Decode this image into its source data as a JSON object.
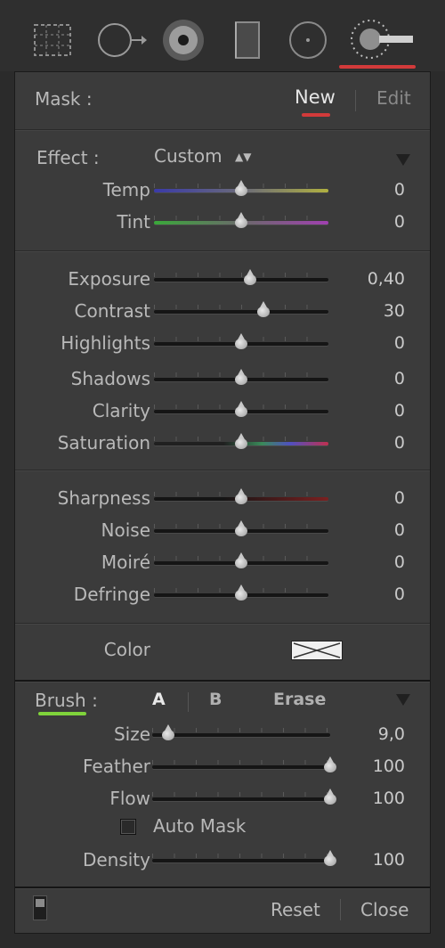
{
  "toolbar": {
    "tools": [
      "crop-overlay-icon",
      "spot-removal-icon",
      "red-eye-icon",
      "graduated-filter-icon",
      "radial-filter-icon",
      "adjustment-brush-icon"
    ]
  },
  "mask": {
    "label": "Mask :",
    "new_label": "New",
    "edit_label": "Edit"
  },
  "effect": {
    "label": "Effect :",
    "value": "Custom"
  },
  "groups": [
    [
      {
        "label": "Temp",
        "value": "0",
        "pos": 0.5,
        "track": "temp"
      },
      {
        "label": "Tint",
        "value": "0",
        "pos": 0.5,
        "track": "tint"
      }
    ],
    [
      {
        "label": "Exposure",
        "value": "0,40",
        "pos": 0.55,
        "track": "plain"
      },
      {
        "label": "Contrast",
        "value": "30",
        "pos": 0.63,
        "track": "plain"
      },
      {
        "label": "Highlights",
        "value": "0",
        "pos": 0.5,
        "track": "plain"
      },
      {
        "label": "Shadows",
        "value": "0",
        "pos": 0.5,
        "track": "plain"
      },
      {
        "label": "Clarity",
        "value": "0",
        "pos": 0.5,
        "track": "plain"
      },
      {
        "label": "Saturation",
        "value": "0",
        "pos": 0.5,
        "track": "saturation"
      }
    ],
    [
      {
        "label": "Sharpness",
        "value": "0",
        "pos": 0.5,
        "track": "sharpness"
      },
      {
        "label": "Noise",
        "value": "0",
        "pos": 0.5,
        "track": "plain"
      },
      {
        "label": "Moiré",
        "value": "0",
        "pos": 0.5,
        "track": "plain"
      },
      {
        "label": "Defringe",
        "value": "0",
        "pos": 0.5,
        "track": "plain"
      }
    ]
  ],
  "color": {
    "label": "Color"
  },
  "brush": {
    "label": "Brush :",
    "a_label": "A",
    "b_label": "B",
    "erase_label": "Erase",
    "sliders": [
      {
        "label": "Size",
        "value": "9,0",
        "pos": 0.09
      },
      {
        "label": "Feather",
        "value": "100",
        "pos": 1.0
      },
      {
        "label": "Flow",
        "value": "100",
        "pos": 1.0
      }
    ],
    "auto_mask_label": "Auto Mask",
    "auto_mask_checked": false,
    "density": {
      "label": "Density",
      "value": "100",
      "pos": 1.0
    }
  },
  "footer": {
    "reset_label": "Reset",
    "close_label": "Close"
  },
  "colors": {
    "accent_red": "#d23a3a",
    "accent_green": "#7fd33b"
  }
}
